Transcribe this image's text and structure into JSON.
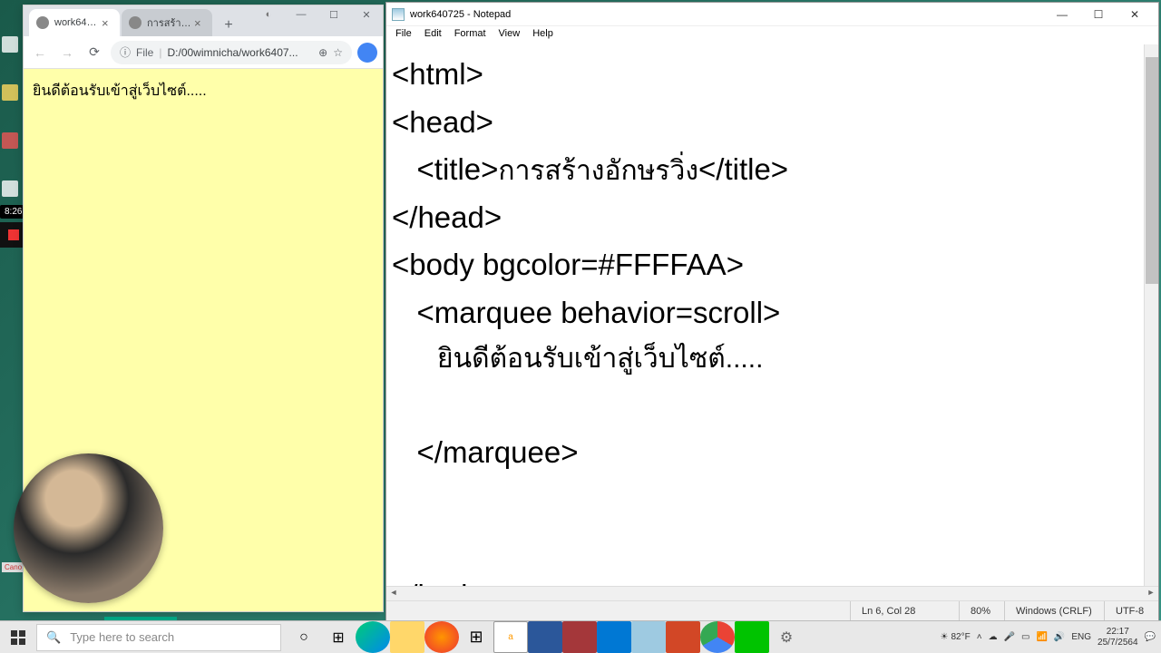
{
  "desktop": {
    "canon": "Cano"
  },
  "recorder": {
    "time": "8:26"
  },
  "chrome": {
    "tabs": [
      {
        "label": "work640...",
        "active": true
      },
      {
        "label": "การสร้างอั",
        "active": false
      }
    ],
    "window_controls": {
      "min": "—",
      "max": "☐",
      "close": "✕"
    },
    "addr": {
      "info_icon": "ⓘ",
      "scheme": "File",
      "path": "D:/00wimnicha/work6407..."
    },
    "content": {
      "marquee_text": "ยินดีต้อนรับเข้าสู่เว็บไซต์....."
    }
  },
  "notepad": {
    "title": "work640725 - Notepad",
    "menu": [
      "File",
      "Edit",
      "Format",
      "View",
      "Help"
    ],
    "code": {
      "l1": "<html>",
      "l2": "<head>",
      "l3a": "   <title>",
      "l3b": "การสร้างอักษรวิ่ง",
      "l3c": "</title>",
      "l4": "</head>",
      "l5": "<body bgcolor=#FFFFAA>",
      "l6": "   <marquee behavior=scroll>",
      "l7": "      ยินดีต้อนรับเข้าสู่เว็บไซต์.....",
      "l8": "",
      "l9": "   </marquee>",
      "l10": "",
      "l11": "",
      "l12": "</body>"
    },
    "status": {
      "pos": "Ln 6, Col 28",
      "zoom": "80%",
      "eol": "Windows (CRLF)",
      "enc": "UTF-8"
    },
    "window_controls": {
      "min": "—",
      "max": "☐",
      "close": "✕"
    }
  },
  "taskbar": {
    "search_placeholder": "Type here to search",
    "tray": {
      "weather": "82°F",
      "lang": "ENG",
      "time": "22:17",
      "date": "25/7/2564"
    }
  }
}
